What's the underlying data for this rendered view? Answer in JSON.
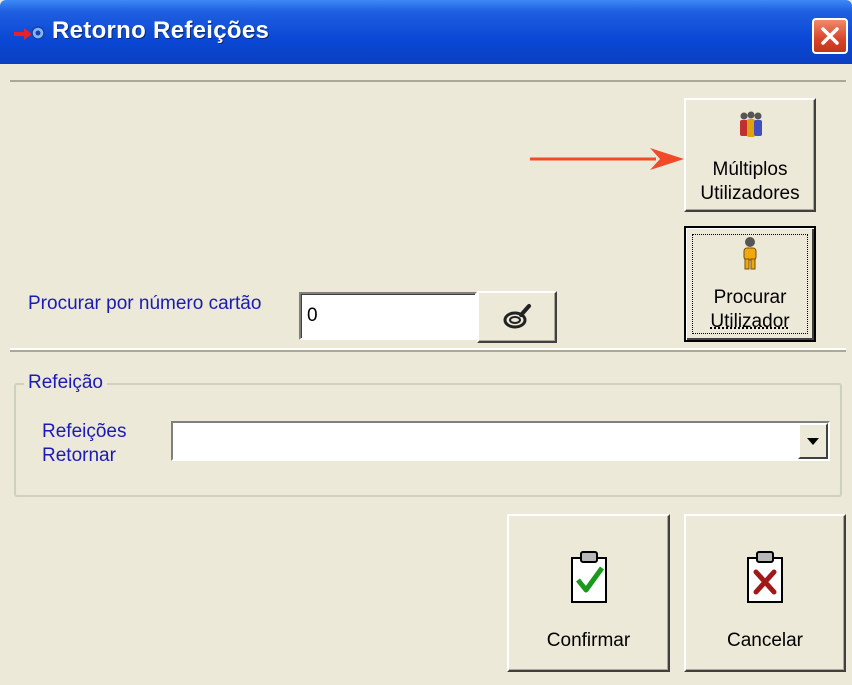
{
  "window": {
    "title": "Retorno Refeições",
    "title_icon": "arrow-star-icon",
    "close_icon": "close-icon"
  },
  "colors": {
    "titlebar": "#0a48d6",
    "label_blue": "#1a1ab5",
    "annotation_arrow": "#f04a2a",
    "close_button": "#d9442a"
  },
  "search": {
    "card_label": "Procurar por número cartão",
    "card_value": "0",
    "search_icon": "magnifier-icon"
  },
  "user_buttons": {
    "multi_line1": "Múltiplos",
    "multi_line2": "Utilizadores",
    "multi_icon": "multiple-users-icon",
    "find_line1": "Procurar",
    "find_line2": "Utilizador",
    "find_icon": "single-user-icon"
  },
  "meal_group": {
    "title": "Refeição",
    "label_line1": "Refeições",
    "label_line2": "Retornar",
    "selected": ""
  },
  "actions": {
    "confirm": "Confirmar",
    "cancel": "Cancelar",
    "confirm_icon": "clipboard-check-icon",
    "cancel_icon": "clipboard-x-icon"
  }
}
